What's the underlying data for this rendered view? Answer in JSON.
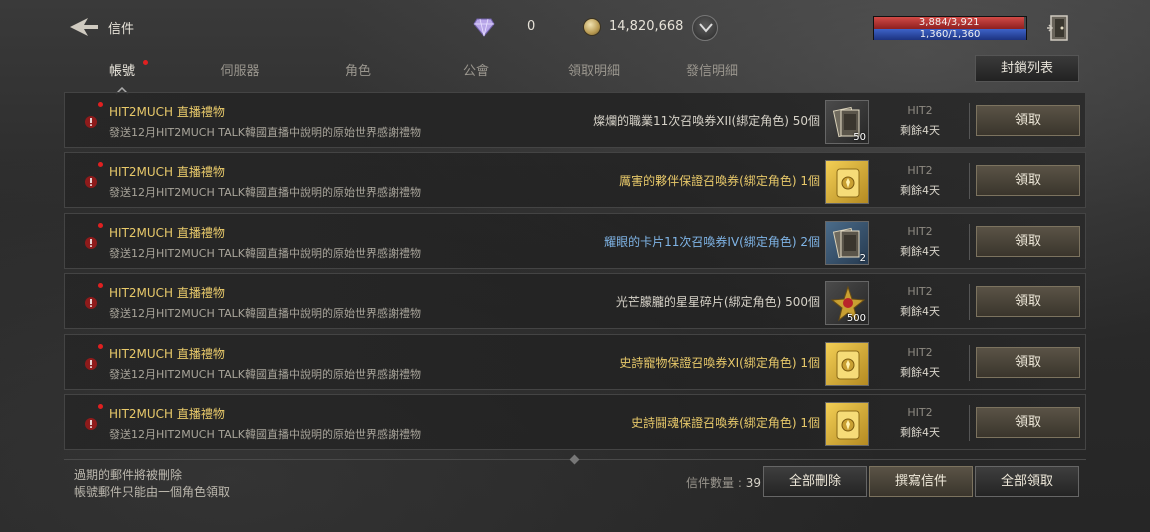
{
  "header": {
    "title": "信件",
    "diamonds": "0",
    "gold": "14,820,668",
    "hp_text": "3,884/3,921",
    "mp_text": "1,360/1,360",
    "hp_fraction": 0.99,
    "mp_fraction": 1.0
  },
  "tabs": [
    {
      "label": "帳號",
      "active": true,
      "has_dot": true
    },
    {
      "label": "伺服器",
      "active": false,
      "has_dot": false
    },
    {
      "label": "角色",
      "active": false,
      "has_dot": false
    },
    {
      "label": "公會",
      "active": false,
      "has_dot": false
    },
    {
      "label": "領取明細",
      "active": false,
      "has_dot": false
    },
    {
      "label": "發信明細",
      "active": false,
      "has_dot": false
    }
  ],
  "blocklist_label": "封鎖列表",
  "mails": [
    {
      "title": "HIT2MUCH 直播禮物",
      "desc": "發送12月HIT2MUCH TALK韓國直播中說明的原始世界感謝禮物",
      "reward": "燦爛的職業11次召喚券XII(綁定角色) 50個",
      "reward_color": "#d6d2c8",
      "icon": "card-icon",
      "icon_style": "dark",
      "count": "50",
      "sender": "HIT2",
      "remain": "剩餘4天",
      "claim": "領取"
    },
    {
      "title": "HIT2MUCH 直播禮物",
      "desc": "發送12月HIT2MUCH TALK韓國直播中說明的原始世界感謝禮物",
      "reward": "厲害的夥伴保證召喚券(綁定角色) 1個",
      "reward_color": "#e8c96a",
      "icon": "gold-scroll-icon",
      "icon_style": "gold",
      "count": "",
      "sender": "HIT2",
      "remain": "剩餘4天",
      "claim": "領取"
    },
    {
      "title": "HIT2MUCH 直播禮物",
      "desc": "發送12月HIT2MUCH TALK韓國直播中說明的原始世界感謝禮物",
      "reward": "耀眼的卡片11次召喚券IV(綁定角色) 2個",
      "reward_color": "#7fb4e6",
      "icon": "card-icon",
      "icon_style": "blue",
      "count": "2",
      "sender": "HIT2",
      "remain": "剩餘4天",
      "claim": "領取"
    },
    {
      "title": "HIT2MUCH 直播禮物",
      "desc": "發送12月HIT2MUCH TALK韓國直播中說明的原始世界感謝禮物",
      "reward": "光芒朦朧的星星碎片(綁定角色) 500個",
      "reward_color": "#d6d2c8",
      "icon": "star-shard-icon",
      "icon_style": "dark",
      "count": "500",
      "sender": "HIT2",
      "remain": "剩餘4天",
      "claim": "領取"
    },
    {
      "title": "HIT2MUCH 直播禮物",
      "desc": "發送12月HIT2MUCH TALK韓國直播中說明的原始世界感謝禮物",
      "reward": "史詩寵物保證召喚券XI(綁定角色) 1個",
      "reward_color": "#e8c96a",
      "icon": "gold-scroll-icon",
      "icon_style": "gold",
      "count": "",
      "sender": "HIT2",
      "remain": "剩餘4天",
      "claim": "領取"
    },
    {
      "title": "HIT2MUCH 直播禮物",
      "desc": "發送12月HIT2MUCH TALK韓國直播中說明的原始世界感謝禮物",
      "reward": "史詩鬪魂保證召喚券(綁定角色) 1個",
      "reward_color": "#e8c96a",
      "icon": "gold-scroll-icon",
      "icon_style": "gold",
      "count": "",
      "sender": "HIT2",
      "remain": "剩餘4天",
      "claim": "領取"
    }
  ],
  "footer": {
    "note1": "過期的郵件將被刪除",
    "note2": "帳號郵件只能由一個角色領取",
    "count_label": "信件數量 : ",
    "count_value": "39",
    "delete_all": "全部刪除",
    "compose": "撰寫信件",
    "claim_all": "全部領取"
  }
}
